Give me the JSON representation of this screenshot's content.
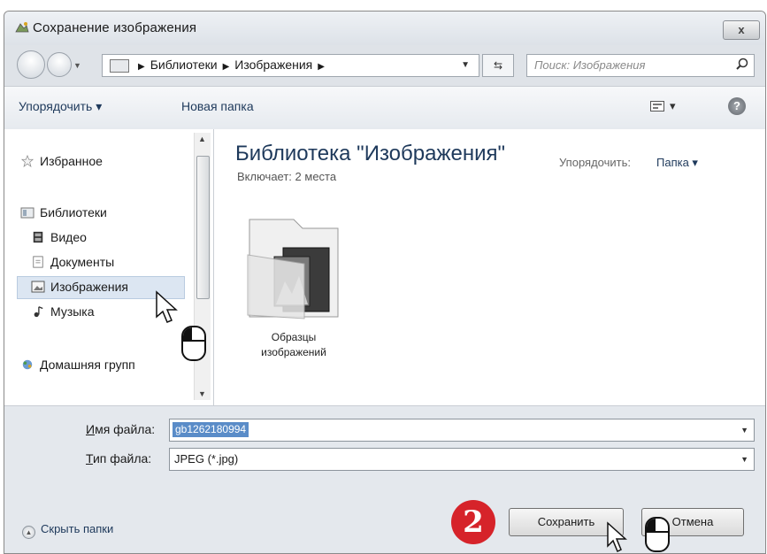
{
  "window": {
    "title": "Сохранение изображения",
    "close_label": "x"
  },
  "address": {
    "path": [
      "Библиотеки",
      "Изображения"
    ],
    "search_placeholder": "Поиск: Изображения"
  },
  "toolbar": {
    "organize_label": "Упорядочить ▾",
    "new_folder_label": "Новая папка",
    "view_label": "▾",
    "help_label": "?"
  },
  "navpane": {
    "items": [
      {
        "label": "Избранное",
        "icon": "star-icon"
      },
      {
        "label": "Библиотеки",
        "icon": "libraries-icon"
      },
      {
        "label": "Видео",
        "icon": "video-icon"
      },
      {
        "label": "Документы",
        "icon": "documents-icon"
      },
      {
        "label": "Изображения",
        "icon": "pictures-icon",
        "selected": true
      },
      {
        "label": "Музыка",
        "icon": "music-icon"
      },
      {
        "label": "Домашняя групп",
        "icon": "homegroup-icon"
      }
    ]
  },
  "content": {
    "library_title": "Библиотека \"Изображения\"",
    "includes": "Включает: 2 места",
    "arrange_label": "Упорядочить:",
    "arrange_value": "Папка ▾",
    "folders": [
      {
        "name_line1": "Образцы",
        "name_line2": "изображений"
      }
    ]
  },
  "form": {
    "filename_label_underlined": "И",
    "filename_label_rest": "мя файла:",
    "filename_value": "gb1262180994",
    "filetype_label_underlined": "Т",
    "filetype_label_rest": "ип файла:",
    "filetype_value": "JPEG (*.jpg)"
  },
  "footer": {
    "hide_folders_label": "Скрыть папки",
    "save_label": "Сохранить",
    "cancel_label": "Отмена"
  },
  "annotation": {
    "step_number": "2",
    "badge_color": "#d6232a"
  }
}
